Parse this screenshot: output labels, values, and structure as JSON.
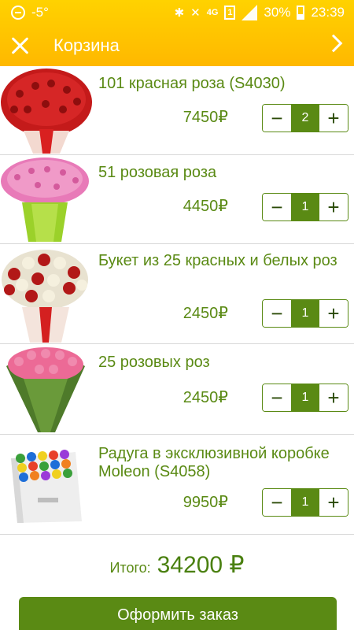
{
  "status_bar": {
    "temperature": "-5°",
    "network": "4G",
    "sim": "1",
    "battery": "30%",
    "time": "23:39"
  },
  "app_bar": {
    "title": "Корзина"
  },
  "items": [
    {
      "title": "101 красная роза (S4030)",
      "price": "7450₽",
      "quantity": "2"
    },
    {
      "title": "51 розовая роза",
      "price": "4450₽",
      "quantity": "1"
    },
    {
      "title": "Букет из 25 красных и белых роз",
      "price": "2450₽",
      "quantity": "1"
    },
    {
      "title": "25 розовых роз",
      "price": "2450₽",
      "quantity": "1"
    },
    {
      "title": "Радуга в эксклюзивной коробке Moleon (S4058)",
      "price": "9950₽",
      "quantity": "1"
    }
  ],
  "stepper": {
    "minus": "−",
    "plus": "+"
  },
  "total": {
    "label": "Итого:",
    "value": "34200 ₽"
  },
  "checkout": {
    "label": "Оформить заказ"
  },
  "colors": {
    "accent": "#5a8a14",
    "appbar": "#ffc800"
  }
}
